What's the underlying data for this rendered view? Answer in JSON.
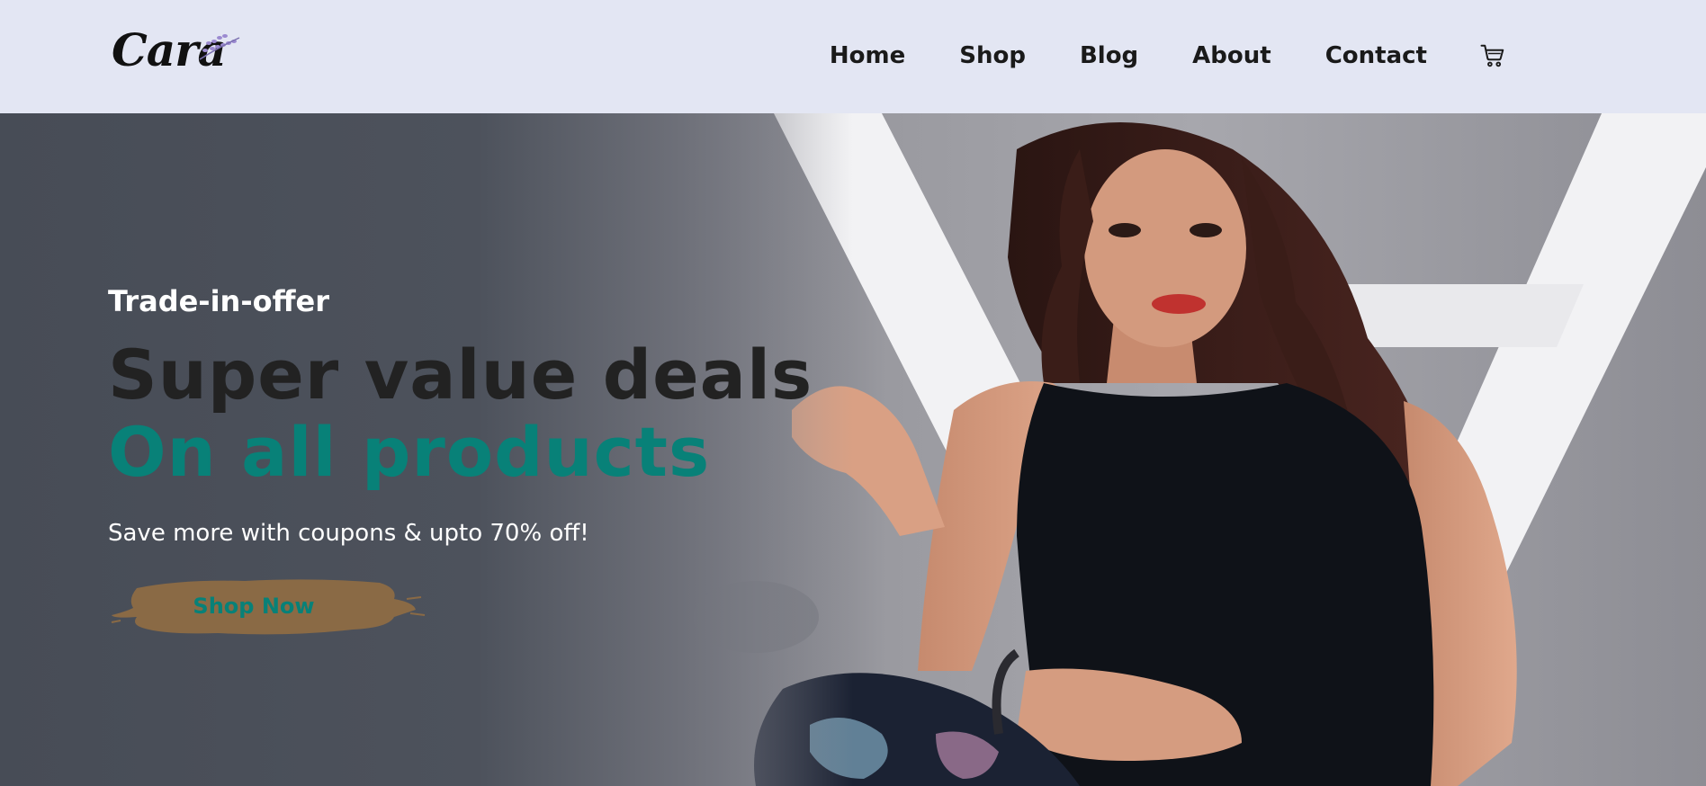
{
  "header": {
    "logo_text": "Cara",
    "nav": [
      "Home",
      "Shop",
      "Blog",
      "About",
      "Contact"
    ],
    "cart_icon": "shopping-cart-icon"
  },
  "hero": {
    "kicker": "Trade-in-offer",
    "headline_1": "Super value deals",
    "headline_2": "On all products",
    "subtext": "Save more with coupons & upto 70% off!",
    "cta_label": "Shop Now"
  },
  "colors": {
    "header_bg": "#e3e6f3",
    "accent_teal": "#088178",
    "headline_dark": "#222222",
    "button_brush": "#8a6a45"
  }
}
